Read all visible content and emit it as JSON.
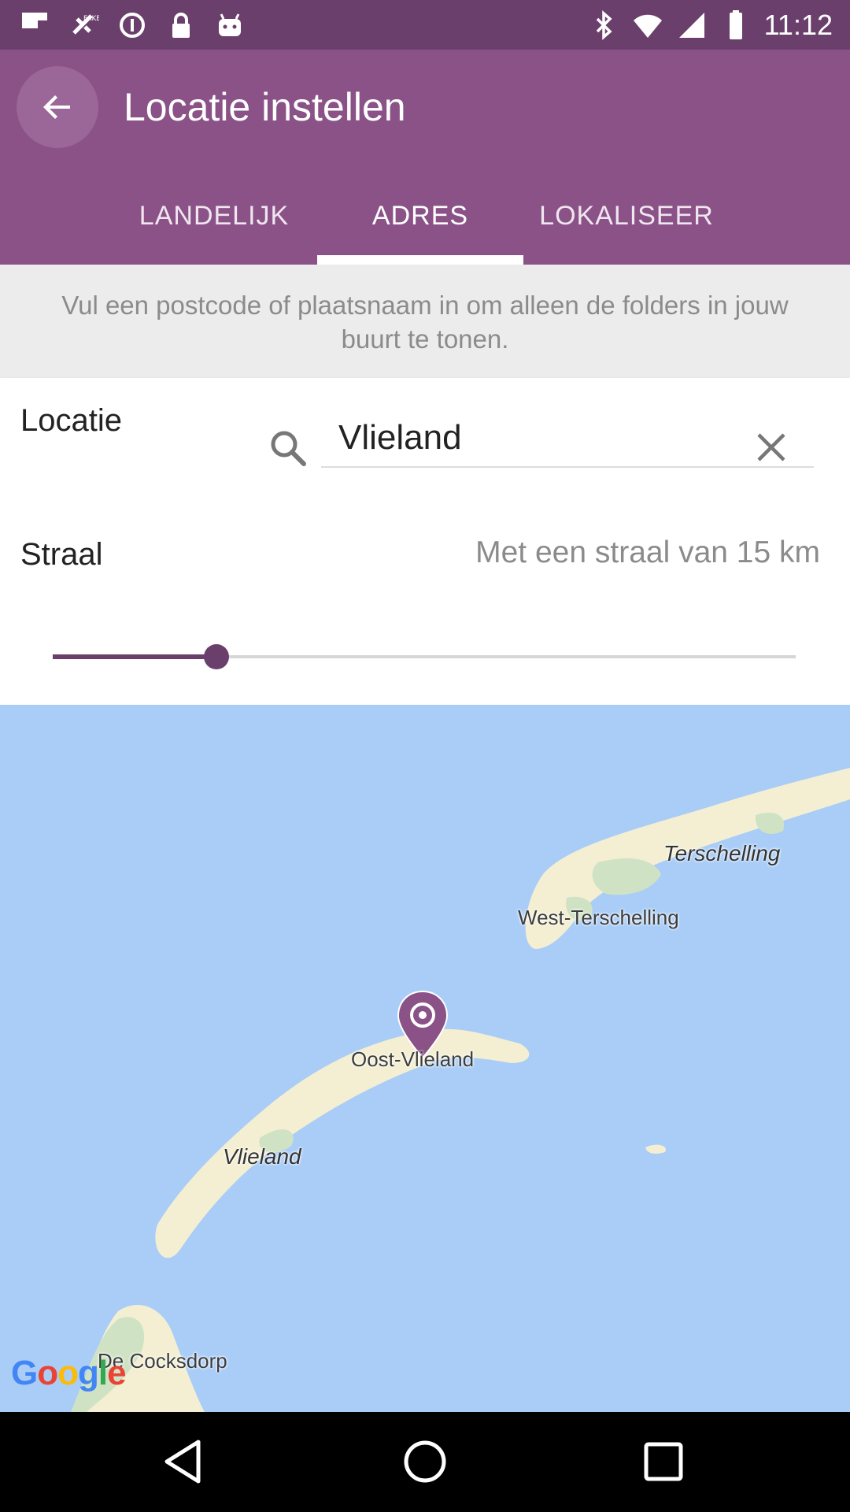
{
  "status_bar": {
    "time": "11:12"
  },
  "app_bar": {
    "title": "Locatie instellen",
    "tabs": [
      {
        "label": "LANDELIJK",
        "selected": false
      },
      {
        "label": "ADRES",
        "selected": true
      },
      {
        "label": "LOKALISEER",
        "selected": false
      }
    ]
  },
  "info_text": "Vul een postcode of plaatsnaam in om alleen de folders in jouw buurt te tonen.",
  "form": {
    "location_label": "Locatie",
    "location_value": "Vlieland",
    "radius_label": "Straal",
    "radius_text": "Met een straal van 15 km",
    "radius_slider_fraction": 0.22
  },
  "map": {
    "labels": {
      "terschelling": "Terschelling",
      "west_terschelling": "West-Terschelling",
      "oost_vlieland": "Oost-Vlieland",
      "vlieland": "Vlieland",
      "de_cocksdorp": "De Cocksdorp"
    },
    "attribution": "Google"
  },
  "colors": {
    "status_bar": "#6b3f6b",
    "app_bar": "#8a5287",
    "accent": "#6b3f6b",
    "water": "#a9cdf7",
    "land": "#f4efd2"
  }
}
